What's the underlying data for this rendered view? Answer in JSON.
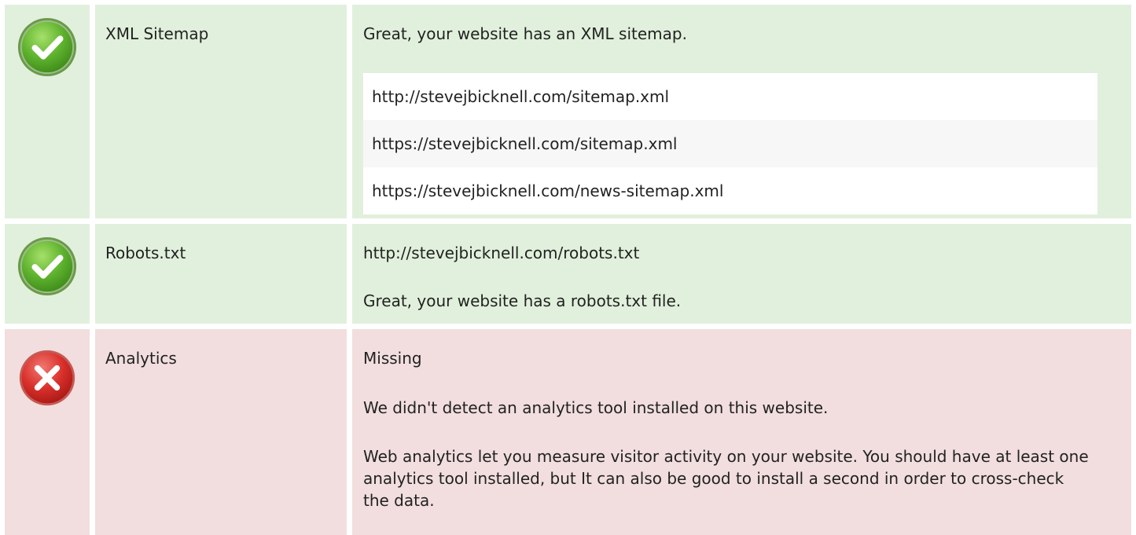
{
  "colors": {
    "pass_bg": "#e1f0dc",
    "fail_bg": "#f2dede",
    "pass_icon": "#5fb32e",
    "fail_icon": "#d9302b"
  },
  "rows": [
    {
      "status": "pass",
      "status_icon": "check-circle-icon",
      "label": "XML Sitemap",
      "message": "Great, your website has an XML sitemap.",
      "sitemaps": [
        "http://stevejbicknell.com/sitemap.xml",
        "https://stevejbicknell.com/sitemap.xml",
        "https://stevejbicknell.com/news-sitemap.xml"
      ]
    },
    {
      "status": "pass",
      "status_icon": "check-circle-icon",
      "label": "Robots.txt",
      "url": "http://stevejbicknell.com/robots.txt",
      "message": "Great, your website has a robots.txt file."
    },
    {
      "status": "fail",
      "status_icon": "error-x-circle-icon",
      "label": "Analytics",
      "state": "Missing",
      "message": "We didn't detect an analytics tool installed on this website.",
      "detail": "Web analytics let you measure visitor activity on your website. You should have at least one analytics tool installed, but It can also be good to install a second in order to cross-check the data."
    }
  ]
}
